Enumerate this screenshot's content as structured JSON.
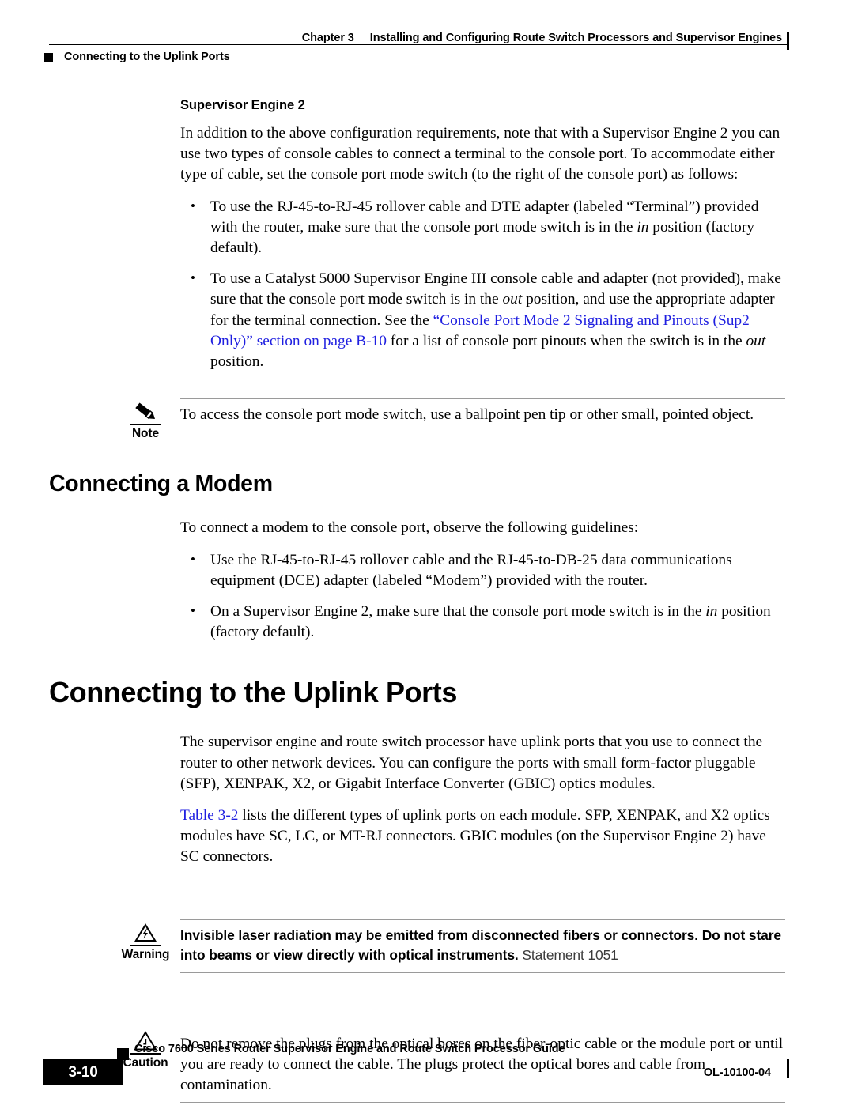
{
  "header": {
    "chapter_num": "Chapter 3",
    "chapter_title": "Installing and Configuring Route Switch Processors and Supervisor Engines",
    "running_head": "Connecting to the Uplink Ports"
  },
  "content": {
    "sup2_heading": "Supervisor Engine 2",
    "sup2_intro": "In addition to the above configuration requirements, note that with a Supervisor Engine 2 you can use two types of console cables to connect a terminal to the console port. To accommodate either type of cable, set the console port mode switch (to the right of the console port) as follows:",
    "bullet1_a": "To use the RJ-45-to-RJ-45 rollover cable and DTE adapter (labeled “Terminal”) provided with the router, make sure that the console port mode switch is in the ",
    "bullet1_italic": "in",
    "bullet1_b": " position (factory default).",
    "bullet2_a": "To use a Catalyst 5000 Supervisor Engine III console cable and adapter (not provided), make sure that the console port mode switch is in the ",
    "bullet2_italic1": "out",
    "bullet2_b": " position, and use the appropriate adapter for the terminal connection. See the ",
    "bullet2_link": "“Console Port Mode 2 Signaling and Pinouts (Sup2 Only)” section on page B-10",
    "bullet2_c": " for a list of console port pinouts when the switch is in the ",
    "bullet2_italic2": "out",
    "bullet2_d": " position.",
    "note_label": "Note",
    "note_text": "To access the console port mode switch, use a ballpoint pen tip or other small, pointed object.",
    "modem_heading": "Connecting a Modem",
    "modem_intro": "To connect a modem to the console port, observe the following guidelines:",
    "modem_bullet1": "Use the RJ-45-to-RJ-45 rollover cable and the RJ-45-to-DB-25 data communications equipment (DCE) adapter (labeled “Modem”) provided with the router.",
    "modem_bullet2_a": "On a Supervisor Engine 2, make sure that the console port mode switch is in the ",
    "modem_bullet2_italic": "in",
    "modem_bullet2_b": " position (factory default).",
    "uplink_heading": "Connecting to the Uplink Ports",
    "uplink_para1": "The supervisor engine and route switch processor have uplink ports that you use to connect the router to other network devices. You can configure the ports with small form-factor pluggable (SFP), XENPAK, X2, or Gigabit Interface Converter (GBIC) optics modules.",
    "uplink_para2_link": "Table 3-2",
    "uplink_para2_rest": " lists the different types of uplink ports on each module. SFP, XENPAK, and X2 optics modules have SC, LC, or MT-RJ connectors. GBIC modules (on the Supervisor Engine 2) have SC connectors.",
    "warning_label": "Warning",
    "warning_text_bold": "Invisible laser radiation may be emitted from disconnected fibers or connectors. Do not stare into beams or view directly with optical instruments.",
    "warning_statement": " Statement 1051",
    "caution_label": "Caution",
    "caution_text": "Do not remove the plugs from the optical bores on the fiber-optic cable or the module port or until you are ready to connect the cable. The plugs protect the optical bores and cable from contamination."
  },
  "footer": {
    "guide_title": "Cisco 7600 Series Router Supervisor Engine and Route Switch Processor Guide",
    "page_number": "3-10",
    "doc_id": "OL-10100-04"
  },
  "icons": {
    "note": "pencil-icon",
    "warning": "warning-triangle-lightning-icon",
    "caution": "caution-triangle-exclamation-icon"
  },
  "colors": {
    "link": "#1f1fe0",
    "rule": "#9a9a9a",
    "text": "#000000"
  }
}
